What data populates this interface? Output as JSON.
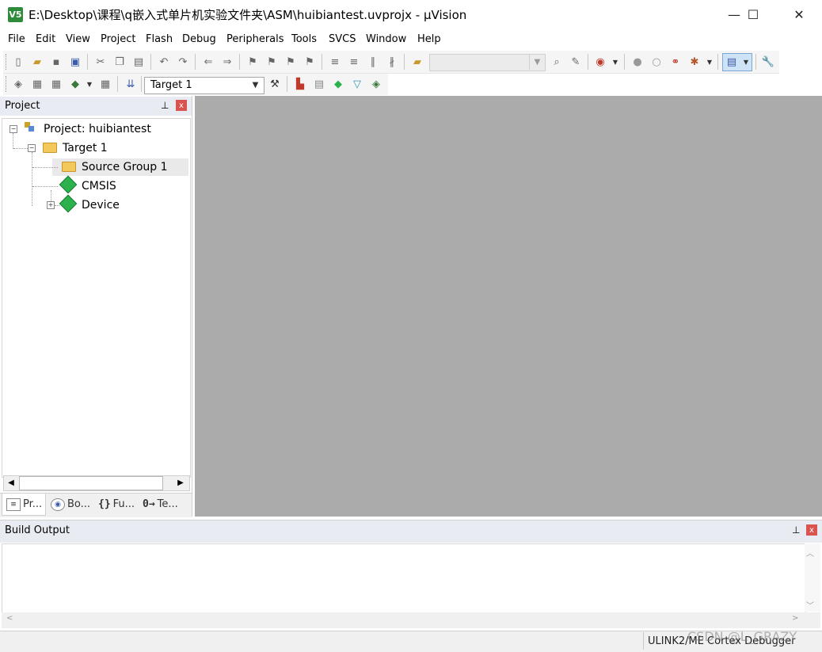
{
  "window": {
    "title": "E:\\Desktop\\课程\\q嵌入式单片机实验文件夹\\ASM\\huibiantest.uvprojx - µVision",
    "app_icon_text": "V5",
    "minimize": "—",
    "maximize": "☐",
    "close": "✕"
  },
  "menu": [
    "File",
    "Edit",
    "View",
    "Project",
    "Flash",
    "Debug",
    "Peripherals",
    "Tools",
    "SVCS",
    "Window",
    "Help"
  ],
  "toolbar": {
    "target_select": "Target 1",
    "find_combo": ""
  },
  "project_panel": {
    "title": "Project",
    "pin": "📌",
    "close": "x",
    "tree": {
      "project": "Project: huibiantest",
      "target": "Target 1",
      "items": [
        "Source Group 1",
        "CMSIS",
        "Device"
      ]
    },
    "tabs": [
      "Pr...",
      "Bo...",
      "Fu...",
      "Te..."
    ]
  },
  "build_output": {
    "title": "Build Output",
    "close": "x"
  },
  "status": {
    "debugger": "ULINK2/ME Cortex Debugger"
  },
  "watermark": "CSDN @L_GRAZY",
  "colors": {
    "editor_bg": "#ababab",
    "panel_header": "#e8ecf2",
    "close_red": "#d9534f",
    "cmsis_green": "#2bb24c"
  }
}
